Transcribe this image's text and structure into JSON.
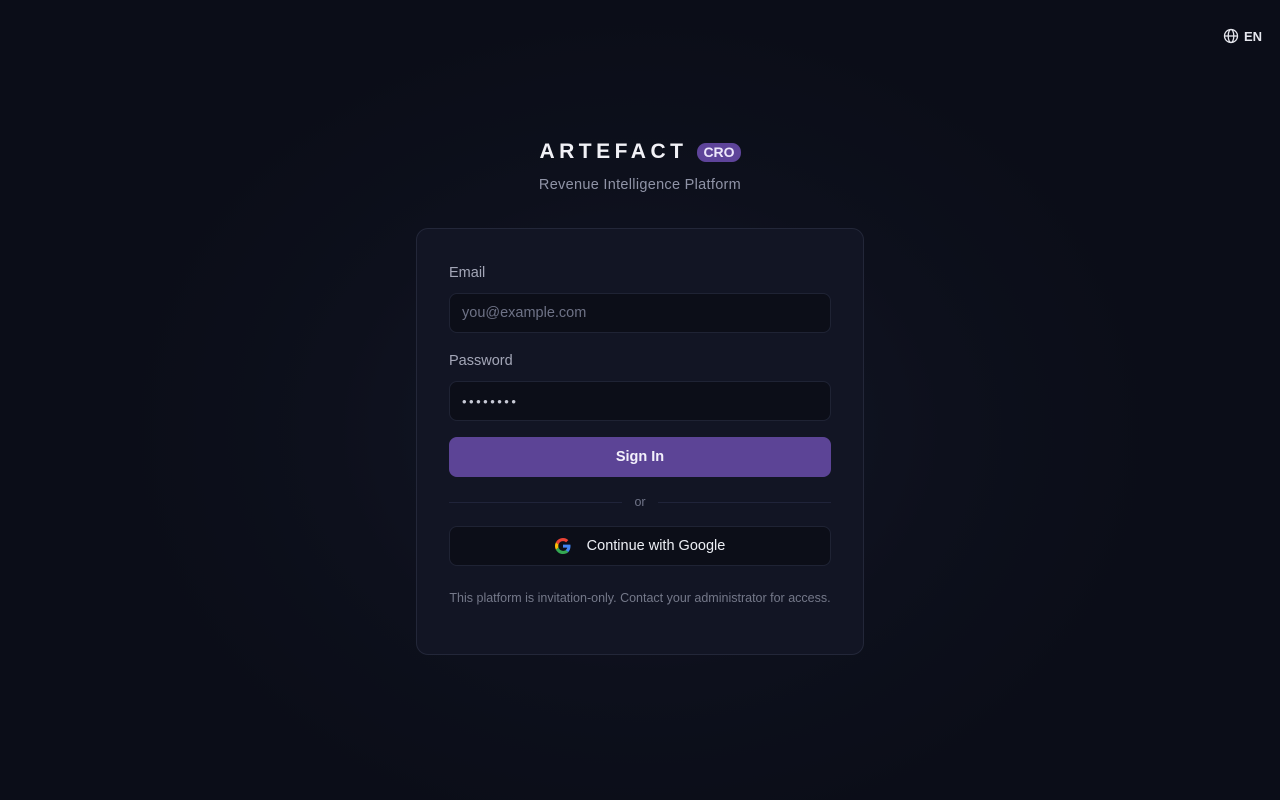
{
  "language": {
    "icon": "globe-icon",
    "code": "EN"
  },
  "brand": {
    "name": "ARTEFACT",
    "badge": "CRO",
    "tagline": "Revenue Intelligence Platform"
  },
  "form": {
    "email_label": "Email",
    "email_placeholder": "you@example.com",
    "email_value": "",
    "password_label": "Password",
    "password_value": "••••••••",
    "signin_label": "Sign In",
    "divider_text": "or",
    "google_icon": "google-icon",
    "google_label": "Continue with Google",
    "notice": "This platform is invitation-only. Contact your administrator for access."
  },
  "colors": {
    "accent": "#5c4496",
    "badge": "#5e449a",
    "background": "#0b0d18",
    "card": "#121524"
  }
}
